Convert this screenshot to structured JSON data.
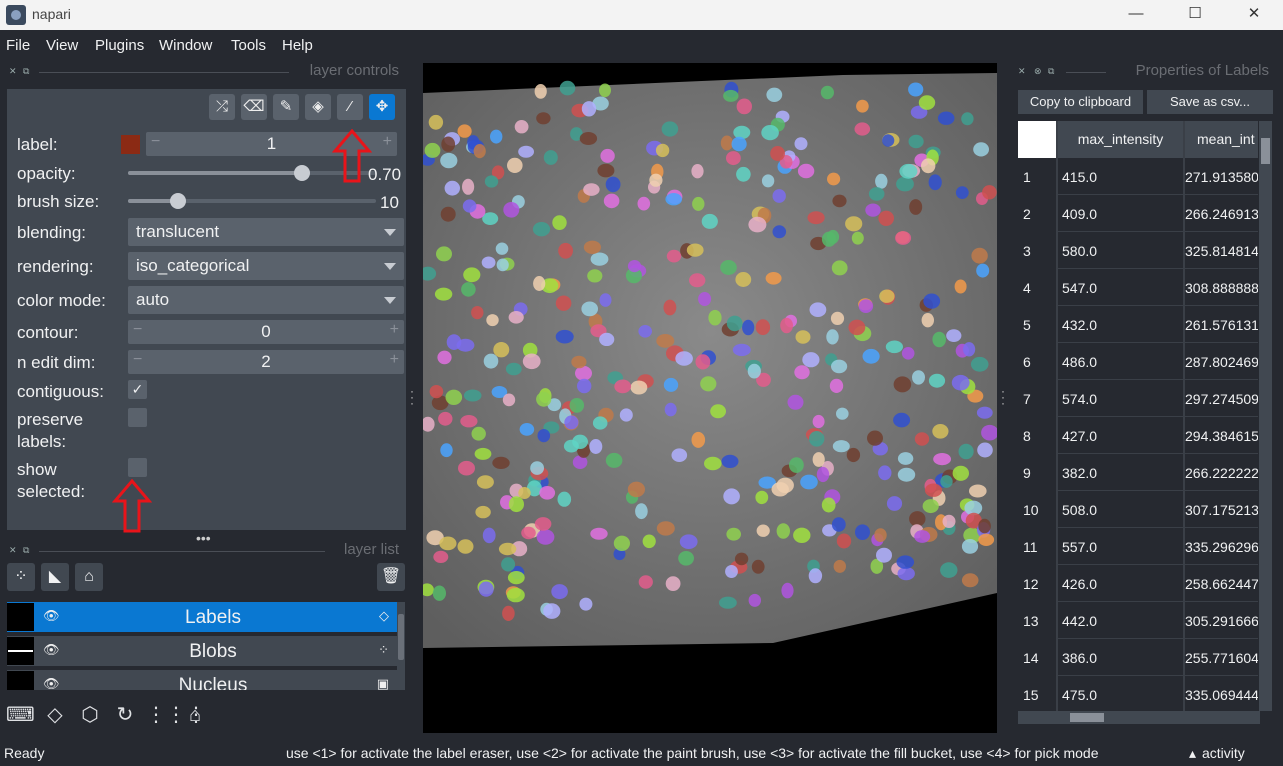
{
  "window": {
    "title": "napari",
    "minimize": "—",
    "maximize": "☐",
    "close": "✕"
  },
  "menu": [
    "File",
    "View",
    "Plugins",
    "Window",
    "Tools",
    "Help"
  ],
  "layer_controls": {
    "header": "layer controls",
    "tools": [
      "shuffle-icon",
      "eraser-icon",
      "paint-brush-icon",
      "fill-bucket-icon",
      "color-picker-icon",
      "pan-zoom-icon"
    ],
    "label": {
      "text": "label:",
      "value": "1",
      "color": "#8b2a14"
    },
    "opacity": {
      "text": "opacity:",
      "value": "0.70",
      "fraction": 0.7
    },
    "brush_size": {
      "text": "brush size:",
      "value": "10",
      "fraction": 0.2
    },
    "blending": {
      "text": "blending:",
      "value": "translucent"
    },
    "rendering": {
      "text": "rendering:",
      "value": "iso_categorical"
    },
    "color_mode": {
      "text": "color mode:",
      "value": "auto"
    },
    "contour": {
      "text": "contour:",
      "value": "0"
    },
    "n_edit_dim": {
      "text": "n edit dim:",
      "value": "2"
    },
    "contiguous": {
      "text": "contiguous:",
      "checked": true
    },
    "preserve_labels": {
      "text1": "preserve",
      "text2": "labels:",
      "checked": false
    },
    "show_selected": {
      "text1": "show",
      "text2": "selected:",
      "checked": false
    }
  },
  "layer_list": {
    "header": "layer list",
    "layers": [
      {
        "name": "Labels",
        "type_icon": "◇",
        "selected": true
      },
      {
        "name": "Blobs",
        "type_icon": "⁘",
        "selected": false
      },
      {
        "name": "Nucleus",
        "type_icon": "▣",
        "selected": false
      }
    ]
  },
  "properties": {
    "header": "Properties of Labels",
    "copy_button": "Copy to clipboard",
    "save_button": "Save as csv...",
    "columns": [
      "max_intensity",
      "mean_int"
    ],
    "rows": [
      [
        "1",
        "415.0",
        "271.913580"
      ],
      [
        "2",
        "409.0",
        "266.246913"
      ],
      [
        "3",
        "580.0",
        "325.814814"
      ],
      [
        "4",
        "547.0",
        "308.888888"
      ],
      [
        "5",
        "432.0",
        "261.576131"
      ],
      [
        "6",
        "486.0",
        "287.802469"
      ],
      [
        "7",
        "574.0",
        "297.274509"
      ],
      [
        "8",
        "427.0",
        "294.384615"
      ],
      [
        "9",
        "382.0",
        "266.222222"
      ],
      [
        "10",
        "508.0",
        "307.175213"
      ],
      [
        "11",
        "557.0",
        "335.296296"
      ],
      [
        "12",
        "426.0",
        "258.662447"
      ],
      [
        "13",
        "442.0",
        "305.291666"
      ],
      [
        "14",
        "386.0",
        "255.771604"
      ],
      [
        "15",
        "475.0",
        "335.069444"
      ]
    ]
  },
  "status": {
    "left": "Ready",
    "hint": "use <1> for activate the label eraser, use <2> for activate the paint brush, use <3> for activate the fill bucket, use <4> for pick mode",
    "activity": "activity"
  }
}
